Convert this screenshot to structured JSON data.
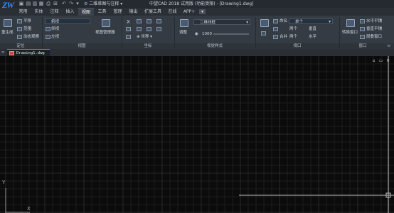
{
  "titlebar": {
    "logo": "ZW",
    "quick_access": [
      "▣",
      "▤",
      "▥",
      "▦",
      "⎙",
      "⊞",
      "↶",
      "↷",
      "▾"
    ],
    "workspace": "二维草图与注释",
    "title": "中望CAD 2018 试用版 (功能受限) - [Drawing1.dwg]"
  },
  "tabs": [
    {
      "label": "常用",
      "active": false
    },
    {
      "label": "实体",
      "active": false
    },
    {
      "label": "注释",
      "active": false
    },
    {
      "label": "插入",
      "active": false
    },
    {
      "label": "视图",
      "active": true
    },
    {
      "label": "工具",
      "active": false
    },
    {
      "label": "管理",
      "active": false
    },
    {
      "label": "输出",
      "active": false
    },
    {
      "label": "扩展工具",
      "active": false
    },
    {
      "label": "在线",
      "active": false
    },
    {
      "label": "APP+",
      "active": false
    }
  ],
  "ribbon": {
    "locate": {
      "label": "定位",
      "big": "重生成",
      "items": [
        "平移",
        "范围",
        "动态观察"
      ]
    },
    "views": {
      "label": "视图",
      "items": [
        "俯视",
        "仰视",
        "左视"
      ],
      "manager": "视图管理器"
    },
    "coords": {
      "label": "坐标",
      "x": "X",
      "world": "世界"
    },
    "visual": {
      "label": "视觉样式",
      "mode": "二维线框",
      "value": "1000",
      "btn": "调整"
    },
    "viewport": {
      "label": "视口",
      "named": "命名",
      "join": "合并",
      "single": "单个",
      "two_v": "两个",
      "vert": "垂直",
      "two_h": "两个",
      "horiz": "水平"
    },
    "window": {
      "label": "窗口",
      "switch": "转换窗口",
      "tile_h": "水平平铺",
      "tile_v": "垂直平铺",
      "cascade": "层叠窗口"
    }
  },
  "document": {
    "tab": "Drawing1.dwg"
  },
  "canvas": {
    "controls": [
      "▫",
      "▭",
      "✕"
    ],
    "ucs_y": "Y",
    "ucs_x": "X"
  },
  "colors": {
    "accent": "#2f8fff",
    "canvas": "#0b0b0b",
    "grid": "#1d1d1d",
    "grid_major": "#2a2a2a"
  }
}
